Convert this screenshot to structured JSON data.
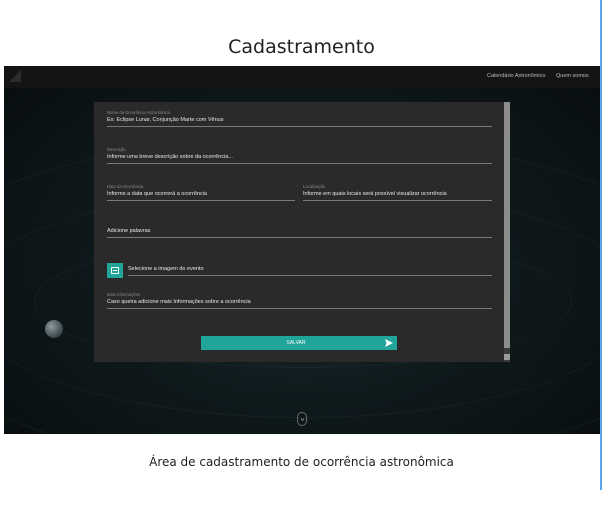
{
  "page_title": "Cadastramento",
  "caption": "Área de cadastramento de ocorrência astronômica",
  "nav": {
    "links": [
      "Calendário Astronômico",
      "Quem somos"
    ]
  },
  "form": {
    "name_label": "Nome da Ocorrência Astronômica",
    "name_value": "Ex: Eclipse Lunar, Conjunção Marte com Vênus",
    "description_label": "Descrição",
    "description_value": "Informe uma breve descrição sobre da ocorrência...",
    "date_label": "Data da Ocorrência",
    "date_value": "Informe a data que ocorrerá a ocorrência",
    "location_label": "Localização",
    "location_value": "Informe em quais locais será possível visualizar ocorrência",
    "keywords_value": "Adicione palavras",
    "image_value": "Selecione a imagem do evento",
    "extra_label": "Mais Informações",
    "extra_value": "Caso queira adicione mais Informações sobre a ocorrência",
    "save_label": "SALVAR"
  },
  "icons": {
    "logo": "logo-icon",
    "image": "image-icon",
    "send": "send-icon",
    "chevron": "chevron-down-icon"
  },
  "colors": {
    "accent": "#21a499",
    "card": "#2a2a2a",
    "navbar": "#141414"
  }
}
